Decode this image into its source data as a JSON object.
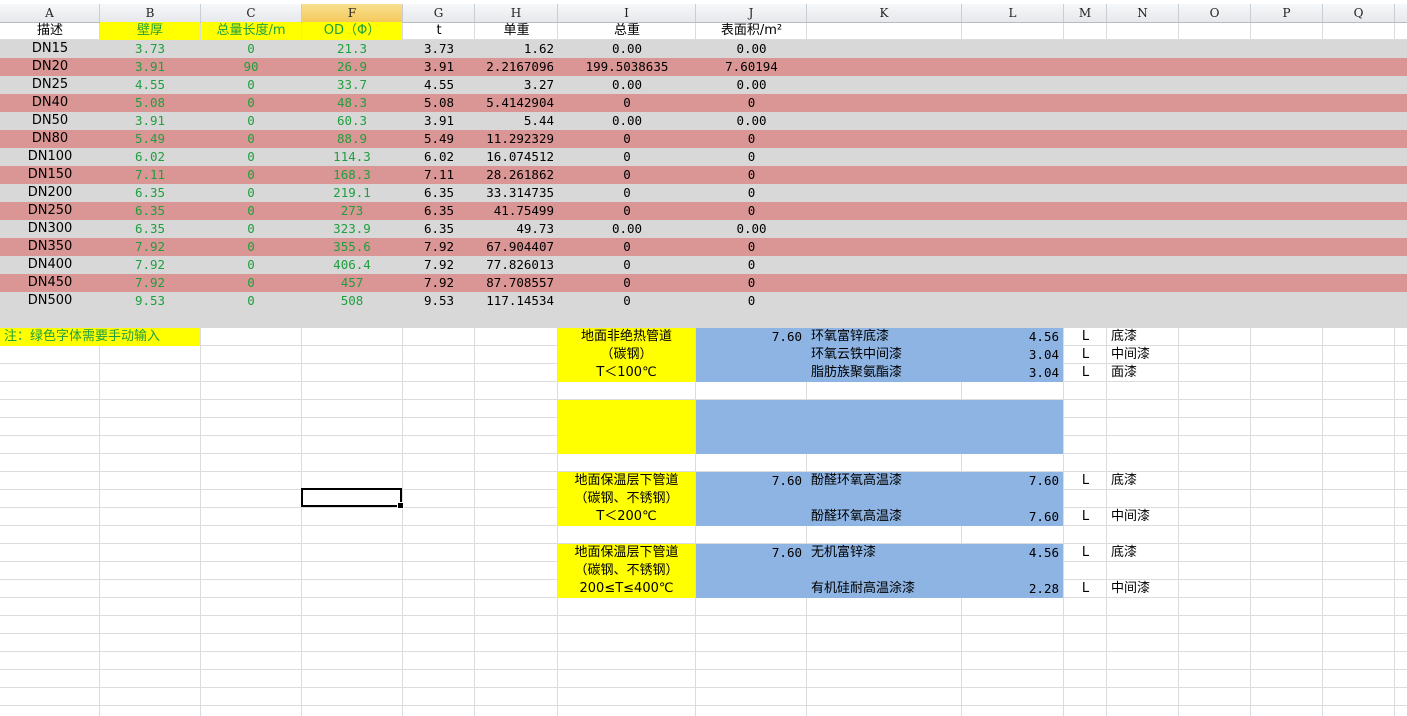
{
  "column_headers": [
    "A",
    "B",
    "C",
    "F",
    "G",
    "H",
    "I",
    "J",
    "K",
    "L",
    "M",
    "N",
    "O",
    "P",
    "Q"
  ],
  "header_row": {
    "desc": "描述",
    "wall": "壁厚",
    "length": "总量长度/m",
    "od": "OD（Φ）",
    "t": "t",
    "unit_weight": "单重",
    "total_weight": "总重",
    "surface": "表面积/m²"
  },
  "rows": [
    {
      "desc": "DN15",
      "wall": "3.73",
      "len": "0",
      "od": "21.3",
      "t": "3.73",
      "uw": "1.62",
      "tw": "0.00",
      "area": "0.00"
    },
    {
      "desc": "DN20",
      "wall": "3.91",
      "len": "90",
      "od": "26.9",
      "t": "3.91",
      "uw": "2.2167096",
      "tw": "199.5038635",
      "area": "7.60194"
    },
    {
      "desc": "DN25",
      "wall": "4.55",
      "len": "0",
      "od": "33.7",
      "t": "4.55",
      "uw": "3.27",
      "tw": "0.00",
      "area": "0.00"
    },
    {
      "desc": "DN40",
      "wall": "5.08",
      "len": "0",
      "od": "48.3",
      "t": "5.08",
      "uw": "5.4142904",
      "tw": "0",
      "area": "0"
    },
    {
      "desc": "DN50",
      "wall": "3.91",
      "len": "0",
      "od": "60.3",
      "t": "3.91",
      "uw": "5.44",
      "tw": "0.00",
      "area": "0.00"
    },
    {
      "desc": "DN80",
      "wall": "5.49",
      "len": "0",
      "od": "88.9",
      "t": "5.49",
      "uw": "11.292329",
      "tw": "0",
      "area": "0"
    },
    {
      "desc": "DN100",
      "wall": "6.02",
      "len": "0",
      "od": "114.3",
      "t": "6.02",
      "uw": "16.074512",
      "tw": "0",
      "area": "0"
    },
    {
      "desc": "DN150",
      "wall": "7.11",
      "len": "0",
      "od": "168.3",
      "t": "7.11",
      "uw": "28.261862",
      "tw": "0",
      "area": "0"
    },
    {
      "desc": "DN200",
      "wall": "6.35",
      "len": "0",
      "od": "219.1",
      "t": "6.35",
      "uw": "33.314735",
      "tw": "0",
      "area": "0"
    },
    {
      "desc": "DN250",
      "wall": "6.35",
      "len": "0",
      "od": "273",
      "t": "6.35",
      "uw": "41.75499",
      "tw": "0",
      "area": "0"
    },
    {
      "desc": "DN300",
      "wall": "6.35",
      "len": "0",
      "od": "323.9",
      "t": "6.35",
      "uw": "49.73",
      "tw": "0.00",
      "area": "0.00"
    },
    {
      "desc": "DN350",
      "wall": "7.92",
      "len": "0",
      "od": "355.6",
      "t": "7.92",
      "uw": "67.904407",
      "tw": "0",
      "area": "0"
    },
    {
      "desc": "DN400",
      "wall": "7.92",
      "len": "0",
      "od": "406.4",
      "t": "7.92",
      "uw": "77.826013",
      "tw": "0",
      "area": "0"
    },
    {
      "desc": "DN450",
      "wall": "7.92",
      "len": "0",
      "od": "457",
      "t": "7.92",
      "uw": "87.708557",
      "tw": "0",
      "area": "0"
    },
    {
      "desc": "DN500",
      "wall": "9.53",
      "len": "0",
      "od": "508",
      "t": "9.53",
      "uw": "117.14534",
      "tw": "0",
      "area": "0"
    }
  ],
  "note": "注：绿色字体需要手动输入",
  "paint_groups": [
    {
      "title_lines": [
        "地面非绝热管道",
        "（碳钢）",
        "T＜100℃"
      ],
      "area": "7.60",
      "items": [
        {
          "name": "环氧富锌底漆",
          "qty": "4.56",
          "unit": "L",
          "type": "底漆"
        },
        {
          "name": "环氧云铁中间漆",
          "qty": "3.04",
          "unit": "L",
          "type": "中间漆"
        },
        {
          "name": "脂肪族聚氨酯漆",
          "qty": "3.04",
          "unit": "L",
          "type": "面漆"
        }
      ]
    },
    {
      "title_lines": [
        "地面保温层下管道",
        "（碳钢、不锈钢）",
        "T＜200℃"
      ],
      "area": "7.60",
      "items": [
        {
          "name": "酚醛环氧高温漆",
          "qty": "7.60",
          "unit": "L",
          "type": "底漆"
        },
        {
          "name": "酚醛环氧高温漆",
          "qty": "7.60",
          "unit": "L",
          "type": "中间漆"
        }
      ]
    },
    {
      "title_lines": [
        "地面保温层下管道",
        "（碳钢、不锈钢）",
        "200≤T≤400℃"
      ],
      "area": "7.60",
      "items": [
        {
          "name": "无机富锌漆",
          "qty": "4.56",
          "unit": "L",
          "type": "底漆"
        },
        {
          "name": "有机硅耐高温涂漆",
          "qty": "2.28",
          "unit": "L",
          "type": "中间漆"
        }
      ]
    }
  ],
  "colors": {
    "grey_row": "#d8d8d8",
    "pink_row": "#da9694",
    "input_green": "#1f9f3f",
    "yellow": "#ffff00",
    "blue": "#8eb4e3"
  }
}
